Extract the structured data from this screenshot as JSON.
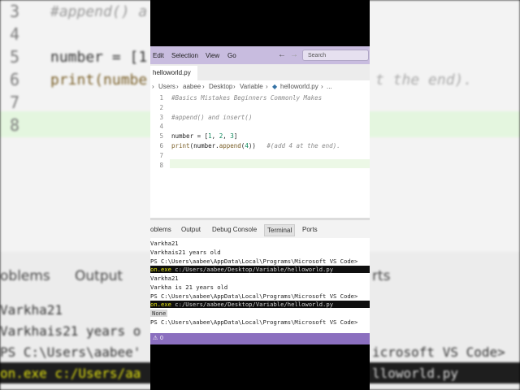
{
  "background": {
    "line_numbers": [
      "3",
      "4",
      "5",
      "6",
      "7",
      "8"
    ],
    "code_lines": [
      "#append() a",
      "",
      "number = [1",
      "print(numbe",
      "",
      ""
    ],
    "code_right": "t the end).",
    "panel_tabs": [
      "oblems",
      "Output",
      "rts"
    ],
    "terminal_lines": [
      "Varkha21",
      "Varkhais21 years o",
      "PS C:\\Users\\aabee'",
      "on.exe c:/Users/aa",
      "icrosoft VS Code>",
      "lloworld.py",
      "rkha21"
    ]
  },
  "window": {
    "menu": [
      "Edit",
      "Selection",
      "View",
      "Go"
    ],
    "search_placeholder": "Search",
    "back_arrow": "←",
    "forward_arrow": "→"
  },
  "editor_tab": {
    "label": "helloworld.py"
  },
  "breadcrumb": {
    "items": [
      "Users",
      "aabee",
      "Desktop",
      "Variable"
    ],
    "file": "helloworld.py",
    "more": "..."
  },
  "editor": {
    "lines": [
      {
        "num": "1",
        "parts": [
          {
            "t": "#Basics Mistakes Beginners Commonly Makes",
            "c": "cmt"
          }
        ]
      },
      {
        "num": "2",
        "parts": []
      },
      {
        "num": "3",
        "parts": [
          {
            "t": "#append() and insert()",
            "c": "cmt"
          }
        ]
      },
      {
        "num": "4",
        "parts": []
      },
      {
        "num": "5",
        "parts": [
          {
            "t": "number = [",
            "c": "kw"
          },
          {
            "t": "1",
            "c": "num"
          },
          {
            "t": ", ",
            "c": "kw"
          },
          {
            "t": "2",
            "c": "num"
          },
          {
            "t": ", ",
            "c": "kw"
          },
          {
            "t": "3",
            "c": "num"
          },
          {
            "t": "]",
            "c": "kw"
          }
        ]
      },
      {
        "num": "6",
        "parts": [
          {
            "t": "print",
            "c": "fn"
          },
          {
            "t": "(number.",
            "c": "kw"
          },
          {
            "t": "append",
            "c": "fn"
          },
          {
            "t": "(",
            "c": "kw"
          },
          {
            "t": "4",
            "c": "num"
          },
          {
            "t": "))   ",
            "c": "kw"
          },
          {
            "t": "#(add 4 at the end).",
            "c": "cmt"
          }
        ]
      },
      {
        "num": "7",
        "parts": []
      },
      {
        "num": "8",
        "parts": []
      }
    ]
  },
  "panel": {
    "tabs": [
      "oblems",
      "Output",
      "Debug Console",
      "Terminal",
      "Ports"
    ],
    "active": "Terminal"
  },
  "terminal": {
    "line1": "Varkha21",
    "line2": "Varkhais21 years old",
    "line3": "PS C:\\Users\\aabee\\AppData\\Local\\Programs\\Microsoft VS Code>",
    "line4_a": "on.exe",
    "line4_b": " c:/Users/aabee/Desktop/Variable/helloworld.py",
    "line5": "Varkha21",
    "line6": "Varkha is 21 years old",
    "line7": "PS C:\\Users\\aabee\\AppData\\Local\\Programs\\Microsoft VS Code>",
    "line8_a": "on.exe",
    "line8_b": " c:/Users/aabee/Desktop/Variable/helloworld.py",
    "line9": "None",
    "line10": "PS C:\\Users\\aabee\\AppData\\Local\\Programs\\Microsoft VS Code>"
  },
  "statusbar": {
    "warnings": "0"
  },
  "colors": {
    "title_bar": "#c8bcdf",
    "status_bar": "#8b6fbf",
    "current_line": "#ecf8e6"
  }
}
